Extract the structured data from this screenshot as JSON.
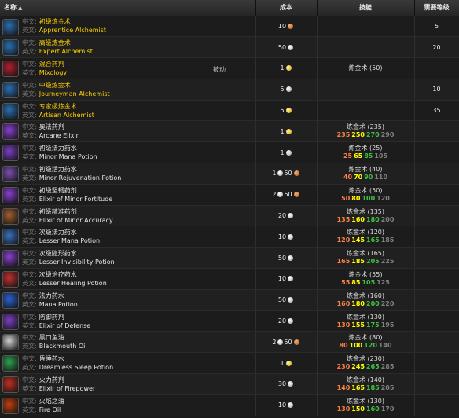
{
  "headers": {
    "name": "名称",
    "sort_icon": "▲",
    "cost": "成本",
    "skill": "技能",
    "req_level": "需要等级"
  },
  "field_labels": {
    "zh": "中文:",
    "en": "英文:"
  },
  "rows": [
    {
      "zh": "初级炼金术",
      "en": "Apprentice Alchemist",
      "icon": "vial-icon",
      "icon_color": "#2a6fb0",
      "yellow": true,
      "passive": "",
      "cost": [
        {
          "v": "10",
          "c": "copper"
        }
      ],
      "skill_name": "",
      "skill_nums": [],
      "req": "5"
    },
    {
      "zh": "高级炼金术",
      "en": "Expert Alchemist",
      "icon": "vial-icon",
      "icon_color": "#2a6fb0",
      "yellow": true,
      "passive": "",
      "cost": [
        {
          "v": "50",
          "c": "silver"
        }
      ],
      "skill_name": "",
      "skill_nums": [],
      "req": "20"
    },
    {
      "zh": "混合药剂",
      "en": "Mixology",
      "icon": "cauldron-icon",
      "icon_color": "#b02030",
      "yellow": true,
      "passive": "被动",
      "cost": [
        {
          "v": "1",
          "c": "gold"
        }
      ],
      "skill_name": "炼金术 (50)",
      "skill_nums": [],
      "req": ""
    },
    {
      "zh": "中级炼金术",
      "en": "Journeyman Alchemist",
      "icon": "vial-icon",
      "icon_color": "#2a6fb0",
      "yellow": true,
      "passive": "",
      "cost": [
        {
          "v": "5",
          "c": "silver"
        }
      ],
      "skill_name": "",
      "skill_nums": [],
      "req": "10"
    },
    {
      "zh": "专家级炼金术",
      "en": "Artisan Alchemist",
      "icon": "vial-icon",
      "icon_color": "#2a6fb0",
      "yellow": true,
      "passive": "",
      "cost": [
        {
          "v": "5",
          "c": "gold"
        }
      ],
      "skill_name": "",
      "skill_nums": [],
      "req": "35"
    },
    {
      "zh": "奥法药剂",
      "en": "Arcane Elixir",
      "icon": "purple-potion-icon",
      "icon_color": "#8a3fd0",
      "yellow": false,
      "passive": "",
      "cost": [
        {
          "v": "1",
          "c": "gold"
        }
      ],
      "skill_name": "炼金术 (235)",
      "skill_nums": [
        "235",
        "250",
        "270",
        "290"
      ],
      "req": ""
    },
    {
      "zh": "初级法力药水",
      "en": "Minor Mana Potion",
      "icon": "purple-potion-icon",
      "icon_color": "#7a3fc0",
      "yellow": false,
      "passive": "",
      "cost": [
        {
          "v": "1",
          "c": "silver"
        }
      ],
      "skill_name": "炼金术 (25)",
      "skill_nums": [
        "25",
        "65",
        "85",
        "105"
      ],
      "req": ""
    },
    {
      "zh": "初级活力药水",
      "en": "Minor Rejuvenation Potion",
      "icon": "flask-icon",
      "icon_color": "#7a4fb0",
      "yellow": false,
      "passive": "",
      "cost": [
        {
          "v": "1",
          "c": "silver"
        },
        {
          "v": "50",
          "c": "copper"
        }
      ],
      "skill_name": "炼金术 (40)",
      "skill_nums": [
        "40",
        "70",
        "90",
        "110"
      ],
      "req": ""
    },
    {
      "zh": "初级坚韧药剂",
      "en": "Elixir of Minor Fortitude",
      "icon": "purple-potion-icon",
      "icon_color": "#8a3fd0",
      "yellow": false,
      "passive": "",
      "cost": [
        {
          "v": "2",
          "c": "silver"
        },
        {
          "v": "50",
          "c": "copper"
        }
      ],
      "skill_name": "炼金术 (50)",
      "skill_nums": [
        "50",
        "80",
        "100",
        "120"
      ],
      "req": ""
    },
    {
      "zh": "初级精准药剂",
      "en": "Elixir of Minor Accuracy",
      "icon": "bowl-icon",
      "icon_color": "#a06030",
      "yellow": false,
      "passive": "",
      "cost": [
        {
          "v": "20",
          "c": "silver"
        }
      ],
      "skill_name": "炼金术 (135)",
      "skill_nums": [
        "135",
        "160",
        "180",
        "200"
      ],
      "req": ""
    },
    {
      "zh": "次级法力药水",
      "en": "Lesser Mana Potion",
      "icon": "blue-vial-icon",
      "icon_color": "#3a70c0",
      "yellow": false,
      "passive": "",
      "cost": [
        {
          "v": "10",
          "c": "silver"
        }
      ],
      "skill_name": "炼金术 (120)",
      "skill_nums": [
        "120",
        "145",
        "165",
        "185"
      ],
      "req": ""
    },
    {
      "zh": "次级隐形药水",
      "en": "Lesser Invisibility Potion",
      "icon": "purple-flask-icon",
      "icon_color": "#8a3fd0",
      "yellow": false,
      "passive": "",
      "cost": [
        {
          "v": "50",
          "c": "silver"
        }
      ],
      "skill_name": "炼金术 (165)",
      "skill_nums": [
        "165",
        "185",
        "205",
        "225"
      ],
      "req": ""
    },
    {
      "zh": "次级治疗药水",
      "en": "Lesser Healing Potion",
      "icon": "red-vial-icon",
      "icon_color": "#c03030",
      "yellow": false,
      "passive": "",
      "cost": [
        {
          "v": "10",
          "c": "silver"
        }
      ],
      "skill_name": "炼金术 (55)",
      "skill_nums": [
        "55",
        "85",
        "105",
        "125"
      ],
      "req": ""
    },
    {
      "zh": "法力药水",
      "en": "Mana Potion",
      "icon": "blue-flask-icon",
      "icon_color": "#2a60d0",
      "yellow": false,
      "passive": "",
      "cost": [
        {
          "v": "50",
          "c": "silver"
        }
      ],
      "skill_name": "炼金术 (160)",
      "skill_nums": [
        "160",
        "180",
        "200",
        "220"
      ],
      "req": ""
    },
    {
      "zh": "防御药剂",
      "en": "Elixir of Defense",
      "icon": "purple-potion-icon",
      "icon_color": "#7a3fc0",
      "yellow": false,
      "passive": "",
      "cost": [
        {
          "v": "20",
          "c": "silver"
        }
      ],
      "skill_name": "炼金术 (130)",
      "skill_nums": [
        "130",
        "155",
        "175",
        "195"
      ],
      "req": ""
    },
    {
      "zh": "黑口鱼油",
      "en": "Blackmouth Oil",
      "icon": "oil-vial-icon",
      "icon_color": "#d0d0d0",
      "yellow": false,
      "passive": "",
      "cost": [
        {
          "v": "2",
          "c": "silver"
        },
        {
          "v": "50",
          "c": "copper"
        }
      ],
      "skill_name": "炼金术 (80)",
      "skill_nums": [
        "80",
        "100",
        "120",
        "140"
      ],
      "req": ""
    },
    {
      "zh": "昏睡药水",
      "en": "Dreamless Sleep Potion",
      "icon": "green-flask-icon",
      "icon_color": "#30a050",
      "yellow": false,
      "passive": "",
      "cost": [
        {
          "v": "1",
          "c": "gold"
        }
      ],
      "skill_name": "炼金术 (230)",
      "skill_nums": [
        "230",
        "245",
        "265",
        "285"
      ],
      "req": ""
    },
    {
      "zh": "火力药剂",
      "en": "Elixir of Firepower",
      "icon": "red-potion-icon",
      "icon_color": "#c03020",
      "yellow": false,
      "passive": "",
      "cost": [
        {
          "v": "30",
          "c": "silver"
        }
      ],
      "skill_name": "炼金术 (140)",
      "skill_nums": [
        "140",
        "165",
        "185",
        "205"
      ],
      "req": ""
    },
    {
      "zh": "火焰之油",
      "en": "Fire Oil",
      "icon": "fire-vial-icon",
      "icon_color": "#c04010",
      "yellow": false,
      "passive": "",
      "cost": [
        {
          "v": "10",
          "c": "silver"
        }
      ],
      "skill_name": "炼金术 (130)",
      "skill_nums": [
        "130",
        "150",
        "160",
        "170"
      ],
      "req": ""
    }
  ]
}
